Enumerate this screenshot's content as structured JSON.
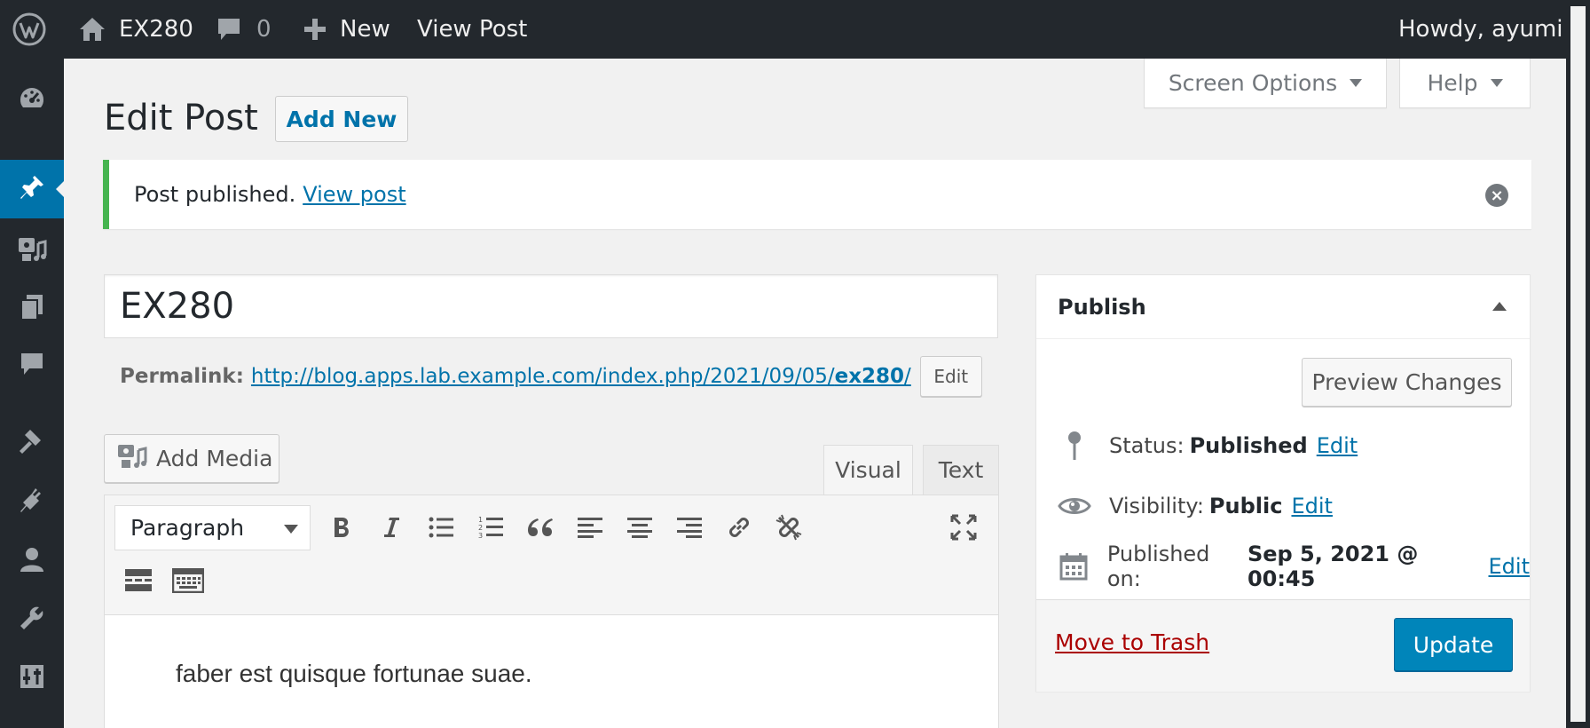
{
  "adminbar": {
    "site_name": "EX280",
    "comments_count": "0",
    "new_label": "New",
    "view_post_label": "View Post",
    "howdy": "Howdy, ayumi"
  },
  "screen_meta": {
    "screen_options_label": "Screen Options",
    "help_label": "Help"
  },
  "page": {
    "title": "Edit Post",
    "add_new_label": "Add New"
  },
  "notice": {
    "message": "Post published.",
    "link_label": "View post"
  },
  "post": {
    "title_value": "EX280",
    "permalink_label": "Permalink:",
    "permalink_base": "http://blog.apps.lab.example.com/index.php/2021/09/05/",
    "permalink_slug": "ex280",
    "permalink_trail": "/",
    "permalink_edit_label": "Edit",
    "content": "faber est quisque fortunae suae."
  },
  "editor": {
    "add_media_label": "Add Media",
    "tab_visual": "Visual",
    "tab_text": "Text",
    "format_selected": "Paragraph"
  },
  "publish": {
    "heading": "Publish",
    "preview_label": "Preview Changes",
    "status_label": "Status:",
    "status_value": "Published",
    "visibility_label": "Visibility:",
    "visibility_value": "Public",
    "published_on_label": "Published on:",
    "published_on_value": "Sep 5, 2021 @ 00:45",
    "edit_label": "Edit",
    "trash_label": "Move to Trash",
    "update_label": "Update"
  },
  "colors": {
    "adminbar_bg": "#23282d",
    "accent": "#0073aa",
    "primary_button": "#0085ba",
    "notice_success": "#46b450",
    "trash": "#aa0000"
  }
}
